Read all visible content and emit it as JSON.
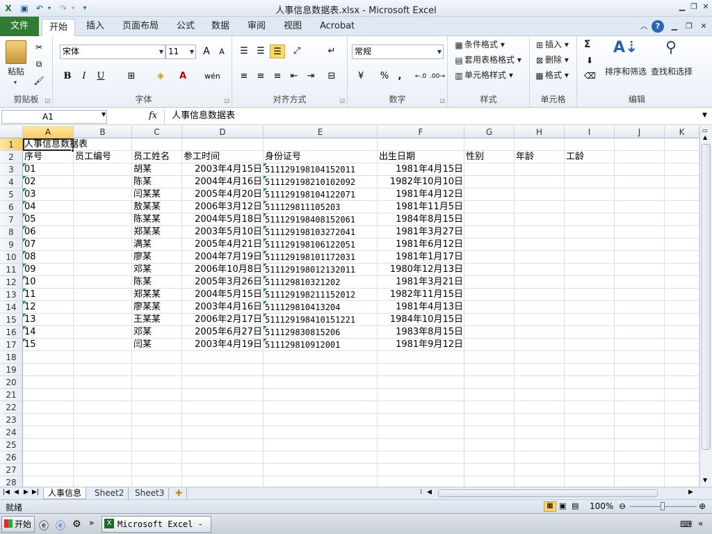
{
  "window": {
    "title": "人事信息数据表.xlsx - Microsoft Excel"
  },
  "ribbon_tabs": [
    "文件",
    "开始",
    "插入",
    "页面布局",
    "公式",
    "数据",
    "审阅",
    "视图",
    "Acrobat"
  ],
  "clipboard": {
    "paste": "粘贴",
    "label": "剪贴板"
  },
  "font": {
    "name": "宋体",
    "size": "11",
    "label": "字体",
    "bold": "B",
    "italic": "I",
    "underline": "U",
    "grow": "A",
    "shrink": "A"
  },
  "alignment": {
    "label": "对齐方式"
  },
  "number": {
    "format": "常规",
    "label": "数字",
    "percent": "%",
    "comma": ","
  },
  "styles": {
    "conditional": "条件格式",
    "table": "套用表格格式",
    "cell": "单元格样式",
    "label": "样式"
  },
  "cells": {
    "insert": "插入",
    "delete": "删除",
    "format": "格式",
    "label": "单元格"
  },
  "editing": {
    "sort": "排序和筛选",
    "find": "查找和选择",
    "label": "编辑",
    "sum": "Σ"
  },
  "formula_bar": {
    "name_box": "A1",
    "fx": "fx",
    "content": "人事信息数据表"
  },
  "grid": {
    "columns": [
      "A",
      "B",
      "C",
      "D",
      "E",
      "F",
      "G",
      "H",
      "I",
      "J",
      "K"
    ],
    "row_numbers": [
      "1",
      "2",
      "3",
      "4",
      "5",
      "6",
      "7",
      "8",
      "9",
      "10",
      "11",
      "12",
      "13",
      "14",
      "15",
      "16",
      "17",
      "18",
      "19",
      "20",
      "21",
      "22",
      "23",
      "24",
      "25",
      "26",
      "27",
      "28"
    ],
    "title": "人事信息数据表",
    "headers": [
      "序号",
      "员工编号",
      "员工姓名",
      "参工时间",
      "身份证号",
      "出生日期",
      "性别",
      "年龄",
      "工龄"
    ],
    "rows": [
      {
        "seq": "01",
        "name": "胡某",
        "start": "2003年4月15日",
        "id": "511129198104152011",
        "birth": "1981年4月15日"
      },
      {
        "seq": "02",
        "name": "陈某",
        "start": "2004年4月16日",
        "id": "511129198210102092",
        "birth": "1982年10月10日"
      },
      {
        "seq": "03",
        "name": "闫某某",
        "start": "2005年4月20日",
        "id": "511129198104122071",
        "birth": "1981年4月12日"
      },
      {
        "seq": "04",
        "name": "敖某某",
        "start": "2006年3月12日",
        "id": "511129811105203",
        "birth": "1981年11月5日"
      },
      {
        "seq": "05",
        "name": "陈某某",
        "start": "2004年5月18日",
        "id": "511129198408152061",
        "birth": "1984年8月15日"
      },
      {
        "seq": "06",
        "name": "郑某某",
        "start": "2003年5月10日",
        "id": "511129198103272041",
        "birth": "1981年3月27日"
      },
      {
        "seq": "07",
        "name": "满某",
        "start": "2005年4月21日",
        "id": "511129198106122051",
        "birth": "1981年6月12日"
      },
      {
        "seq": "08",
        "name": "廖某",
        "start": "2004年7月19日",
        "id": "511129198101172031",
        "birth": "1981年1月17日"
      },
      {
        "seq": "09",
        "name": "邓某",
        "start": "2006年10月8日",
        "id": "511129198012132011",
        "birth": "1980年12月13日"
      },
      {
        "seq": "10",
        "name": "陈某",
        "start": "2005年3月26日",
        "id": "511129810321202",
        "birth": "1981年3月21日"
      },
      {
        "seq": "11",
        "name": "郑某某",
        "start": "2004年5月15日",
        "id": "511129198211152012",
        "birth": "1982年11月15日"
      },
      {
        "seq": "12",
        "name": "廖某某",
        "start": "2003年4月16日",
        "id": "511129810413204",
        "birth": "1981年4月13日"
      },
      {
        "seq": "13",
        "name": "王某某",
        "start": "2006年2月17日",
        "id": "511129198410151221",
        "birth": "1984年10月15日"
      },
      {
        "seq": "14",
        "name": "邓某",
        "start": "2005年6月27日",
        "id": "511129830815206",
        "birth": "1983年8月15日"
      },
      {
        "seq": "15",
        "name": "闫某",
        "start": "2003年4月19日",
        "id": "511129810912001",
        "birth": "1981年9月12日"
      }
    ]
  },
  "sheets": [
    "人事信息",
    "Sheet2",
    "Sheet3"
  ],
  "status": {
    "ready": "就绪",
    "zoom": "100%"
  },
  "taskbar": {
    "start": "开始",
    "excel_task": "Microsoft Excel - ..."
  }
}
